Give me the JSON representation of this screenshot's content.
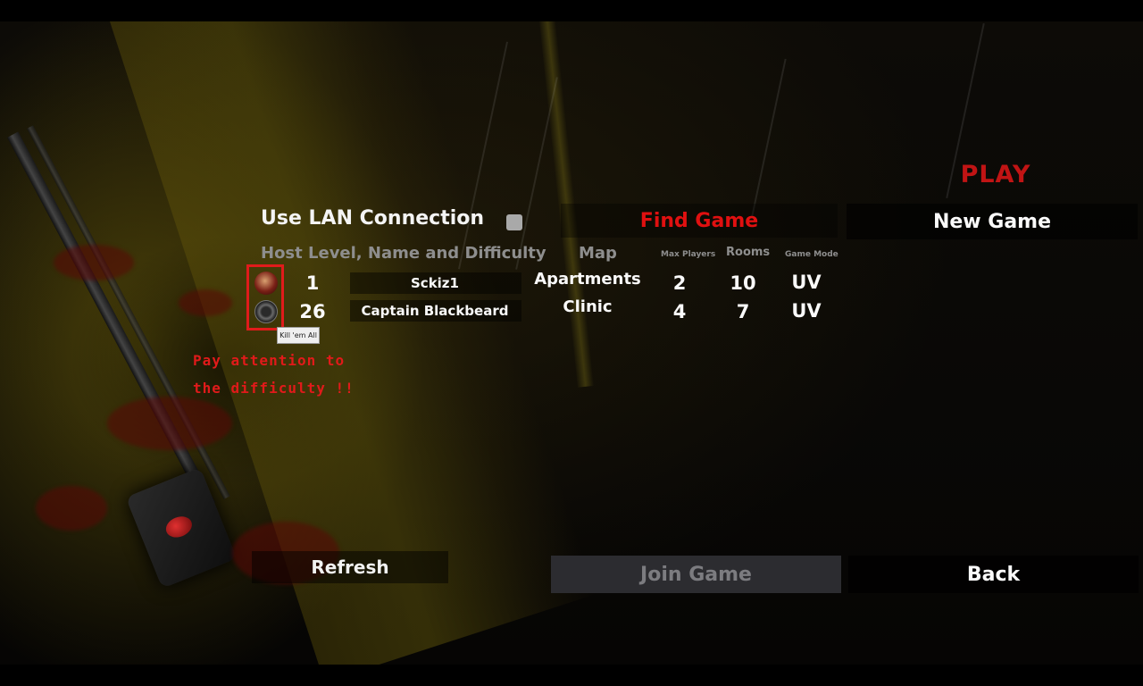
{
  "play_title": "PLAY",
  "lan": {
    "label": "Use LAN Connection",
    "checked": false
  },
  "tabs": {
    "find_game": "Find Game",
    "new_game": "New Game"
  },
  "table": {
    "headers": {
      "host": "Host Level, Name and Difficulty",
      "map": "Map",
      "max_players": "Max Players",
      "rooms": "Rooms",
      "game_mode": "Game Mode"
    },
    "rows": [
      {
        "level": "1",
        "name": "Sckiz1",
        "map": "Apartments",
        "max_players": "2",
        "rooms": "10",
        "mode": "UV",
        "difficulty_icon": "skull-flame-icon"
      },
      {
        "level": "26",
        "name": "Captain Blackbeard",
        "map": "Clinic",
        "max_players": "4",
        "rooms": "7",
        "mode": "UV",
        "difficulty_icon": "kill-em-all-icon"
      }
    ]
  },
  "tooltip": "Kill 'em All",
  "warning": {
    "line1": "Pay attention to",
    "line2": "the difficulty !!"
  },
  "buttons": {
    "refresh": "Refresh",
    "join_game": "Join Game",
    "back": "Back"
  },
  "colors": {
    "accent_red": "#e01010",
    "disabled_text": "#7c7c80"
  }
}
